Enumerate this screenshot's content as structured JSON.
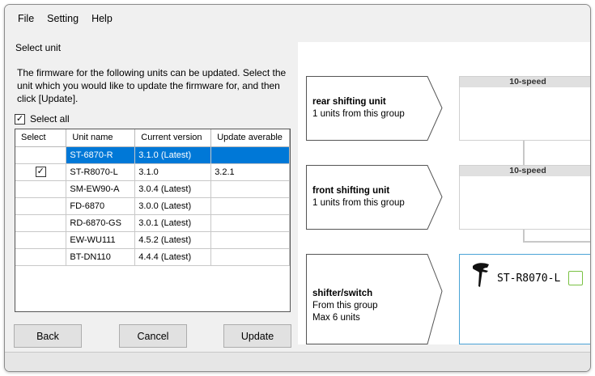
{
  "menu": {
    "items": [
      "File",
      "Setting",
      "Help"
    ]
  },
  "left": {
    "title": "Select unit",
    "description": "The firmware for the following units can be updated. Select the unit which you would like to update the firmware for, and then click [Update].",
    "select_all_label": "Select all",
    "table": {
      "headers": [
        "Select",
        "Unit name",
        "Current version",
        "Update averable"
      ],
      "rows": [
        {
          "checked": false,
          "selected": true,
          "unit": "ST-6870-R",
          "current": "3.1.0 (Latest)",
          "update": ""
        },
        {
          "checked": true,
          "selected": false,
          "unit": "ST-R8070-L",
          "current": "3.1.0",
          "update": "3.2.1"
        },
        {
          "checked": false,
          "selected": false,
          "unit": "SM-EW90-A",
          "current": "3.0.4 (Latest)",
          "update": ""
        },
        {
          "checked": false,
          "selected": false,
          "unit": "FD-6870",
          "current": "3.0.0 (Latest)",
          "update": ""
        },
        {
          "checked": false,
          "selected": false,
          "unit": "RD-6870-GS",
          "current": "3.0.1 (Latest)",
          "update": ""
        },
        {
          "checked": false,
          "selected": false,
          "unit": "EW-WU111",
          "current": "4.5.2 (Latest)",
          "update": ""
        },
        {
          "checked": false,
          "selected": false,
          "unit": "BT-DN110",
          "current": "4.4.4 (Latest)",
          "update": ""
        }
      ]
    },
    "buttons": {
      "back": "Back",
      "cancel": "Cancel",
      "update": "Update"
    }
  },
  "right": {
    "groups": {
      "rear": {
        "title": "rear shifting unit",
        "subtitle": "1 units from this group",
        "box_header": "10-speed"
      },
      "front": {
        "title": "front shifting unit",
        "subtitle": "1 units from this group",
        "box_header": "10-speed"
      },
      "shifter": {
        "title": "shifter/switch",
        "line1": "From this group",
        "line2": "Max 6 units",
        "item_name": "ST-R8070-L"
      }
    }
  }
}
